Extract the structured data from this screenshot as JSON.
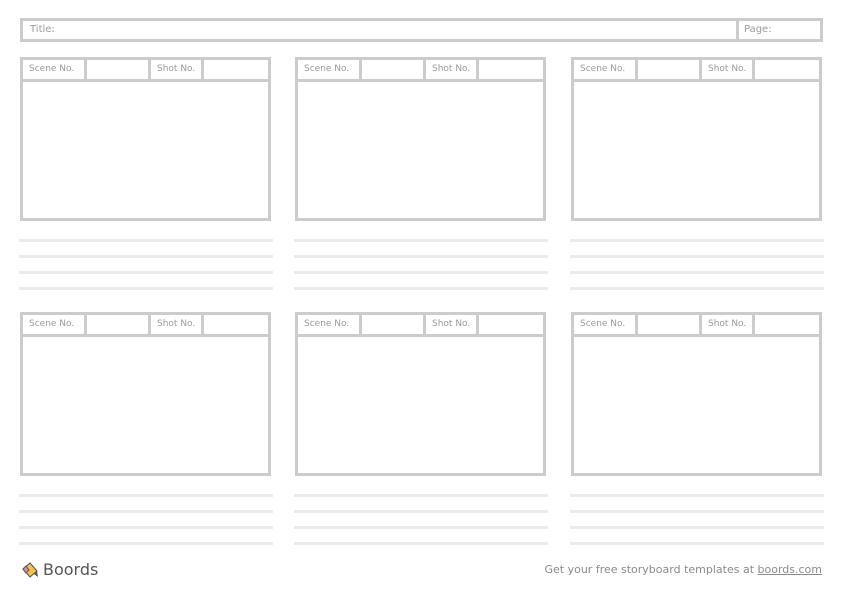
{
  "header": {
    "title_label": "Title:",
    "page_label": "Page:"
  },
  "panels": [
    {
      "scene_label": "Scene No.",
      "shot_label": "Shot No."
    },
    {
      "scene_label": "Scene No.",
      "shot_label": "Shot No."
    },
    {
      "scene_label": "Scene No.",
      "shot_label": "Shot No."
    },
    {
      "scene_label": "Scene No.",
      "shot_label": "Shot No."
    },
    {
      "scene_label": "Scene No.",
      "shot_label": "Shot No."
    },
    {
      "scene_label": "Scene No.",
      "shot_label": "Shot No."
    }
  ],
  "footer": {
    "brand": "Boords",
    "promo_text": "Get your free storyboard templates at ",
    "link_text": "boords.com"
  },
  "colors": {
    "border": "#cccccc",
    "lines": "#ebebeb",
    "label": "#9a9a9a"
  }
}
